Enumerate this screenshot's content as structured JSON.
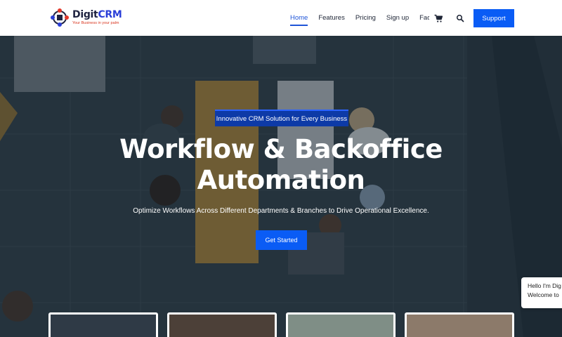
{
  "brand": {
    "name_part1": "Digit",
    "name_part2": "CRM",
    "tagline": "Your Business in your palm"
  },
  "nav": {
    "items": [
      {
        "label": "Home",
        "active": true
      },
      {
        "label": "Features"
      },
      {
        "label": "Pricing"
      },
      {
        "label": "Sign up"
      },
      {
        "label": "Faq"
      }
    ],
    "cart_icon": "cart-icon",
    "search_icon": "search-icon",
    "support_label": "Support"
  },
  "hero": {
    "badge": "Innovative CRM Solution for Every Business",
    "title_line1": "Workflow & Backoffice",
    "title_line2": "Automation",
    "subtitle": "Optimize Workflows Across Different Departments & Branches to Drive Operational Excellence.",
    "cta_label": "Get Started"
  },
  "chat": {
    "line1": "Hello I'm Dig",
    "line2": "Welcome to"
  },
  "colors": {
    "accent": "#0a5cf5",
    "brand_dark": "#1f2340",
    "brand_blue": "#2b3fd8",
    "badge_bg": "#0d3aa7"
  }
}
